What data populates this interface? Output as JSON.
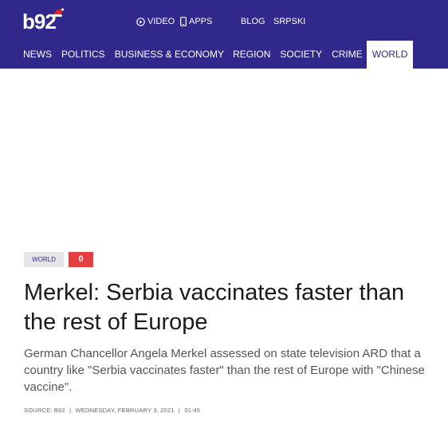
{
  "header": {
    "logo_text": "b92",
    "top_links": [
      {
        "label": "VIDEO",
        "icon": "play-circle-icon"
      },
      {
        "label": "APPS",
        "icon": "smartphone-icon"
      },
      {
        "label": "BLOG"
      },
      {
        "label": "SRPSKI"
      }
    ],
    "nav": [
      "NEWS",
      "POLITICS",
      "BUSINESS & ECONOMY",
      "REGION",
      "SOCIETY",
      "CRIME",
      "WORLD"
    ],
    "active_nav": "WORLD",
    "colors": {
      "brand": "#30288a",
      "accent_red": "#e53f3f"
    }
  },
  "article": {
    "category": "WORLD",
    "comment_count": "0",
    "title": "Merkel: Serbia vaccinates faster than the rest of Europe",
    "lead": "German Chancellor Angela Merkel assessed on state television ARD that a country like \"Serbia vaccinates faster\" than the rest of Europe with \"Chinese vaccine\".",
    "meta": {
      "source": "SOURCE: B92",
      "date": "WEDNESDAY, FEBRUARY 3, 2021",
      "time": "01:45",
      "separator": "|"
    }
  }
}
